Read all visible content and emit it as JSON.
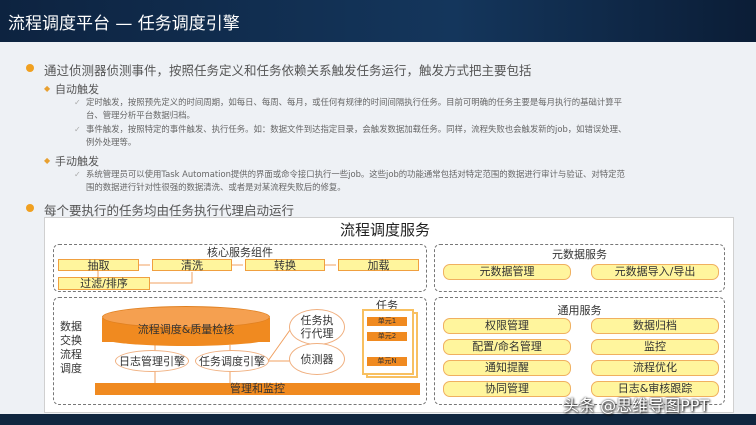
{
  "title": "流程调度平台 — 任务调度引擎",
  "bullets": {
    "b1": "通过侦测器侦测事件，按照任务定义和任务依赖关系触发任务运行，触发方式把主要包括",
    "auto": "自动触发",
    "auto_d1a": "定时触发，按照预先定义的时间周期，如每日、每周、每月，或任何有规律的时间间隔执行任务。目前可明确的任务主要是每月执行的基础计算平",
    "auto_d1b": "台、管理分析平台数据归档。",
    "auto_d2a": "事件触发，按照特定的事件触发、执行任务。如：数据文件到达指定目录，会触发数据加载任务。同样，流程失败也会触发新的job，如错误处理、",
    "auto_d2b": "例外处理等。",
    "manual": "手动触发",
    "man_d1a": "系统管理员可以使用Task Automation提供的界面或命令接口执行一些job。这些job的功能通常包括对特定范围的数据进行审计与验证、对特定范",
    "man_d1b": "围的数据进行针对性很强的数据清洗、或者是对某流程失败后的修复。",
    "b2": "每个要执行的任务均由任务执行代理启动运行"
  },
  "diagram": {
    "title": "流程调度服务",
    "core": {
      "title": "核心服务组件",
      "steps": [
        "抽取",
        "清洗",
        "转换",
        "加载"
      ],
      "filter": "过滤/排序"
    },
    "exchange": {
      "label": [
        "数据",
        "交换",
        "流程",
        "调度"
      ],
      "db": "流程调度&质量检核",
      "log": "日志管理引擎",
      "sched": "任务调度引擎",
      "agent": [
        "任务执",
        "行代理"
      ],
      "detector": "侦测器",
      "task_title": "任务",
      "units": [
        "单元1",
        "单元2",
        "单元N"
      ],
      "monitor": "管理和监控"
    },
    "meta": {
      "title": "元数据服务",
      "items": [
        "元数据管理",
        "元数据导入/导出"
      ]
    },
    "general": {
      "title": "通用服务",
      "items": [
        "权限管理",
        "数据归档",
        "配置/命名管理",
        "监控",
        "通知提醒",
        "流程优化",
        "协同管理",
        "日志&审核跟踪"
      ]
    }
  },
  "watermark": "头条 @思维导图PPT"
}
